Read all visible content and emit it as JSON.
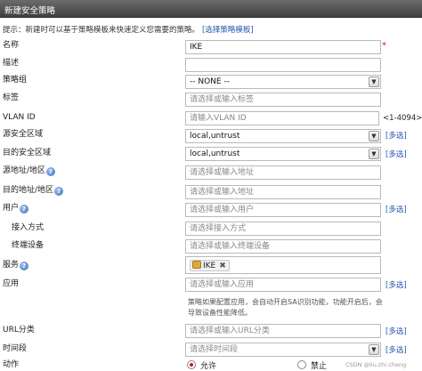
{
  "title": "新建安全策略",
  "hint": {
    "text": "提示：新建时可以基于策略模板来快速定义您需要的策略。",
    "link": "[选择策略模板]"
  },
  "labels": {
    "name": "名称",
    "desc": "描述",
    "group": "策略组",
    "tag": "标签",
    "vlan": "VLAN ID",
    "src_zone": "源安全区域",
    "dst_zone": "目的安全区域",
    "src_addr": "源地址/地区",
    "dst_addr": "目的地址/地区",
    "user": "用户",
    "access": "接入方式",
    "terminal": "终端设备",
    "service": "服务",
    "app": "应用",
    "url": "URL分类",
    "time": "时间段",
    "action": "动作"
  },
  "fields": {
    "name": "IKE",
    "desc": "",
    "group": "-- NONE --",
    "tag_ph": "请选择或输入标签",
    "vlan_ph": "请输入VLAN ID",
    "vlan_range": "<1-4094>",
    "src_zone": "local,untrust",
    "dst_zone": "local,untrust",
    "src_addr_ph": "请选择或输入地址",
    "dst_addr_ph": "请选择或输入地址",
    "user_ph": "请选择或输入用户",
    "access_ph": "请选择接入方式",
    "terminal_ph": "请选择或输入终端设备",
    "service_chip": "IKE",
    "app_ph": "请选择或输入应用",
    "app_note": "策略如果配置应用，会自动开启SA识别功能，功能开启后，会导致设备性能降低。",
    "url_ph": "请选择或输入URL分类",
    "time_ph": "请选择时间段"
  },
  "required_mark": "*",
  "multi_label": "[多选]",
  "action": {
    "allow": "允许",
    "deny": "禁止",
    "selected": "allow"
  },
  "watermark": "CSDN @liu.zhi cheng"
}
